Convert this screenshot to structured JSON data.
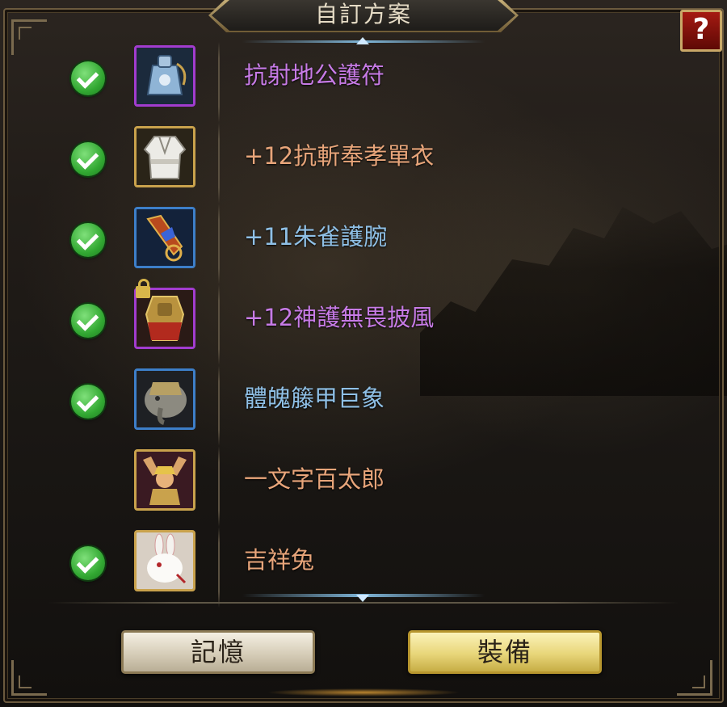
{
  "window": {
    "title": "自訂方案",
    "help_label": "?"
  },
  "items": [
    {
      "name": "抗射地公護符",
      "checked": true,
      "locked": false,
      "rarity": "purple",
      "name_color": "#c77be6",
      "icon": "amulet-pouch-icon"
    },
    {
      "name": "+12抗斬奉孝單衣",
      "checked": true,
      "locked": false,
      "rarity": "gold",
      "name_color": "#e8a57a",
      "icon": "white-robe-icon"
    },
    {
      "name": "+11朱雀護腕",
      "checked": true,
      "locked": false,
      "rarity": "blue",
      "name_color": "#8fc0e6",
      "icon": "bracer-icon"
    },
    {
      "name": "+12神護無畏披風",
      "checked": true,
      "locked": true,
      "rarity": "purple",
      "name_color": "#c77be6",
      "icon": "armored-warrior-cape-icon"
    },
    {
      "name": "體魄籐甲巨象",
      "checked": true,
      "locked": false,
      "rarity": "blue",
      "name_color": "#8fc0e6",
      "icon": "armored-elephant-icon"
    },
    {
      "name": "一文字百太郎",
      "checked": false,
      "locked": false,
      "rarity": "gold",
      "name_color": "#e8a57a",
      "icon": "warrior-arms-raised-icon"
    },
    {
      "name": "吉祥兔",
      "checked": true,
      "locked": false,
      "rarity": "gold",
      "name_color": "#e8a57a",
      "icon": "white-rabbit-icon"
    }
  ],
  "buttons": {
    "memory_label": "記憶",
    "equip_label": "裝備"
  }
}
